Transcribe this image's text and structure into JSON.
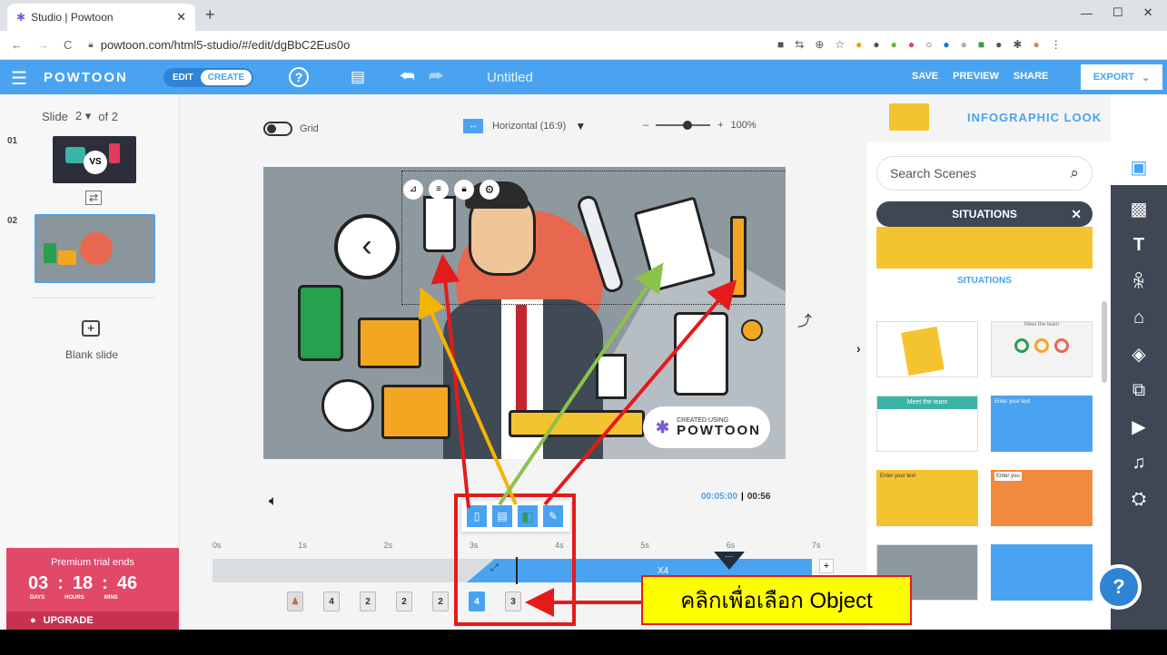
{
  "browser": {
    "tab_title": "Studio | Powtoon",
    "url": "powtoon.com/html5-studio/#/edit/dgBbC2Eus0o"
  },
  "header": {
    "logo": "POWTOON",
    "mode_edit": "EDIT",
    "mode_create": "CREATE",
    "title": "Untitled",
    "save": "SAVE",
    "preview": "PREVIEW",
    "share": "SHARE",
    "export": "EXPORT"
  },
  "slides": {
    "label": "Slide",
    "current": "2",
    "of": "of 2",
    "items": [
      {
        "num": "01",
        "vs": "VS"
      },
      {
        "num": "02"
      }
    ],
    "blank": "Blank slide"
  },
  "canvas": {
    "grid": "Grid",
    "orientation": "Horizontal (16:9)",
    "zoom": "100%",
    "watermark_top": "CREATED USING",
    "watermark": "POWTOON"
  },
  "time": {
    "current": "00:05:00",
    "total": "00:56",
    "ticks": [
      "0s",
      "1s",
      "2s",
      "3s",
      "4s",
      "5s",
      "6s",
      "7s"
    ],
    "x4": "X4",
    "chips": [
      "4",
      "2",
      "2",
      "2",
      "4",
      "3"
    ]
  },
  "trial": {
    "title": "Premium trial ends",
    "days": "03",
    "hours": "18",
    "mins": "46",
    "days_l": "DAYS",
    "hours_l": "HOURS",
    "mins_l": "MINS",
    "upgrade": "UPGRADE"
  },
  "library": {
    "look": "INFOGRAPHIC LOOK",
    "search_placeholder": "Search Scenes",
    "category": "SITUATIONS",
    "banner_label": "SITUATIONS",
    "scenes": [
      {
        "text": "Meet the team"
      },
      {
        "text": "Meet the team"
      },
      {
        "text": "Enter your text"
      },
      {
        "text": "Enter your text"
      },
      {
        "text": "Enter you"
      }
    ]
  },
  "annotation": {
    "callout": "คลิกเพื่อเลือก Object"
  }
}
